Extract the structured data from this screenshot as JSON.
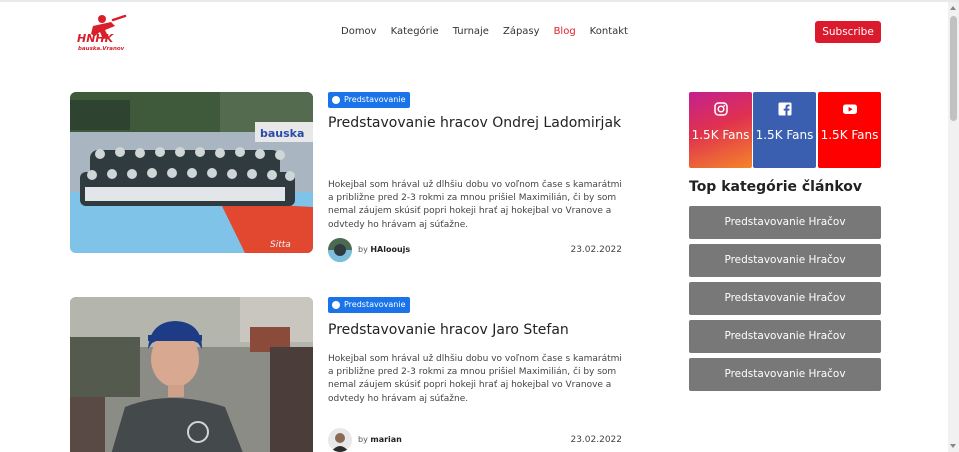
{
  "header": {
    "logo_text": "HNHK bauska.Vranov",
    "nav": [
      "Domov",
      "Kategórie",
      "Turnaje",
      "Zápasy",
      "Blog",
      "Kontakt"
    ],
    "active_nav": "Blog",
    "subscribe_label": "Subscribe"
  },
  "articles": [
    {
      "badge": "Predstavovanie",
      "title": "Predstavovanie hracov Ondrej Ladomirjak",
      "excerpt": "Hokejbal som hrával už dlhšiu dobu vo voľnom čase s kamarátmi a približne pred 2-3 rokmi za mnou prišiel Maximilián, či by som nemal záujem skúsiť popri hokeji hrať aj hokejbal vo Vranove a odvtedy ho hrávam aj súťažne.",
      "by": "by",
      "author": "HAlooujs",
      "date": "23.02.2022"
    },
    {
      "badge": "Predstavovanie",
      "title": "Predstavovanie hracov Jaro Stefan",
      "excerpt": "Hokejbal som hrával už dlhšiu dobu vo voľnom čase s kamarátmi a približne pred 2-3 rokmi za mnou prišiel Maximilián, či by som nemal záujem skúsiť popri hokeji hrať aj hokejbal vo Vranove a odvtedy ho hrávam aj súťažne.",
      "by": "by",
      "author": "marian",
      "date": "23.02.2022"
    }
  ],
  "sidebar": {
    "social": [
      {
        "network": "instagram",
        "icon": "instagram-icon",
        "count": "1.5K Fans"
      },
      {
        "network": "facebook",
        "icon": "facebook-icon",
        "count": "1.5K Fans"
      },
      {
        "network": "youtube",
        "icon": "youtube-icon",
        "count": "1.5K Fans"
      }
    ],
    "categories_title": "Top kategórie článkov",
    "categories": [
      "Predstavovanie Hračov",
      "Predstavovanie Hračov",
      "Predstavovanie Hračov",
      "Predstavovanie Hračov",
      "Predstavovanie Hračov"
    ]
  },
  "colors": {
    "accent_red": "#dc1a2d",
    "badge_blue": "#1a73e8",
    "category_gray": "#787878",
    "facebook_blue": "#3b5fb0",
    "youtube_red": "#ff0000"
  }
}
